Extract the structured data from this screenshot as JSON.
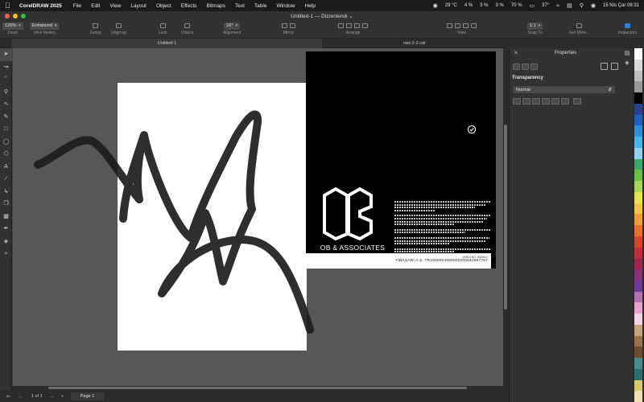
{
  "menubar": {
    "app": "CorelDRAW 2025",
    "items": [
      "File",
      "Edit",
      "View",
      "Layout",
      "Object",
      "Effects",
      "Bitmaps",
      "Text",
      "Table",
      "Window",
      "Help"
    ],
    "status": {
      "cpu": "29 °C",
      "gpu": "4 %",
      "mem": "3 %",
      "net": "3 %",
      "battery": "70 %",
      "temp": "37°",
      "datetime": "15 Nis Çar 08:31"
    }
  },
  "titlebar": {
    "title": "Untitled-1 — Düzenlendi ⌄"
  },
  "toolbar": {
    "zoom_value": "126%",
    "zoom_label": "Zoom",
    "viewmodes_value": "Enhanced",
    "viewmodes_label": "View Modes",
    "group_label": "Group",
    "ungroup_label": "Ungroup",
    "lock_label": "Lock",
    "unlock_label": "Unlock",
    "alignment_value": "16°",
    "alignment_label": "Alignment",
    "mirror_label": "Mirror",
    "arrange_label": "Arrange",
    "view_label": "View",
    "snapto_value": "1:1",
    "snapto_label": "Snap To",
    "getmore_label": "Get More...",
    "inspectors_label": "Inspectors"
  },
  "doctabs": {
    "active": "Untitled-1",
    "second": "naz-2-2.cdr"
  },
  "canvas": {
    "brand_name": "OB & ASSOCIATES",
    "tax_label": "VERGİ NO: 4520001",
    "tax_text": "FİBAŞARI A.Ş. TR2800004009002000642897767"
  },
  "pagebar": {
    "page_count": "1 of 1",
    "page_tab": "Page 1"
  },
  "properties": {
    "title": "Properties",
    "section": "Transparency",
    "mode": "Normal"
  },
  "colors": {
    "accent": "#2f7de0",
    "close": "#ff5f57",
    "minimize": "#febc2e",
    "zoom": "#28c840",
    "palette": [
      "#ffffff",
      "#d9d9d9",
      "#bfbfbf",
      "#999999",
      "#000000",
      "#2a3f8f",
      "#1f5fbf",
      "#2f8fd8",
      "#46b7e8",
      "#8fd3f0",
      "#3aa86b",
      "#6cc04a",
      "#a5d65a",
      "#e6e34a",
      "#f4c542",
      "#f29b38",
      "#e8702a",
      "#d9452b",
      "#c42d3a",
      "#a3234f",
      "#8a2f7c",
      "#6e3a95",
      "#b56fb5",
      "#e9a3c9",
      "#f6d3e3",
      "#c7a27a",
      "#9c7248",
      "#6e4b2a",
      "#4a8a8a",
      "#2e6e6e",
      "#d8c86a",
      "#eee0b0"
    ]
  }
}
